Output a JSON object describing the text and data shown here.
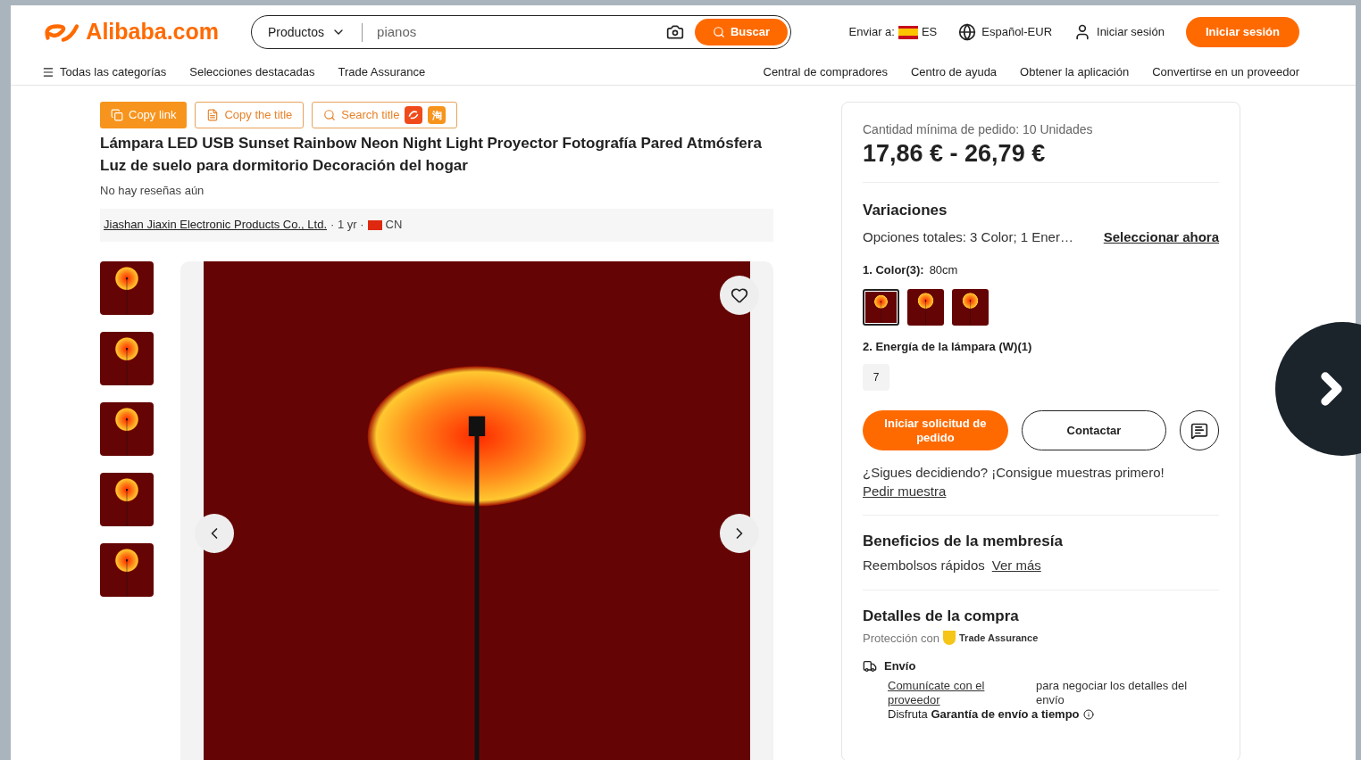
{
  "header": {
    "logo": "Alibaba.com",
    "search": {
      "category": "Productos",
      "value": "pianos",
      "button": "Buscar"
    },
    "ship_to": {
      "label": "Enviar a:",
      "country": "ES"
    },
    "language": "Español-EUR",
    "sign_in_link": "Iniciar sesión",
    "sign_in_button": "Iniciar sesión"
  },
  "nav": {
    "left": [
      "Todas las categorías",
      "Selecciones destacadas",
      "Trade Assurance"
    ],
    "right": [
      "Central de compradores",
      "Centro de ayuda",
      "Obtener la aplicación",
      "Convertirse en un proveedor"
    ]
  },
  "tools": [
    {
      "label": "Copy link",
      "kind": "filled"
    },
    {
      "label": "Copy the title",
      "kind": "outline"
    },
    {
      "label": "Search title",
      "kind": "search",
      "badge": "淘"
    }
  ],
  "product": {
    "title": "Lámpara LED USB Sunset Rainbow Neon Night Light Proyector Fotografía Pared Atmósfera Luz de suelo para dormitorio Decoración del hogar",
    "reviews": "No hay reseñas aún",
    "supplier": {
      "name": "Jiashan Jiaxin Electronic Products Co., Ltd.",
      "years": "· 1 yr ·",
      "country": "CN"
    }
  },
  "gallery": {
    "thumbnails": [
      {
        "selected": false
      },
      {
        "selected": false
      },
      {
        "selected": false
      },
      {
        "selected": false
      },
      {
        "selected": false
      }
    ]
  },
  "order": {
    "min_order": "Cantidad mínima de pedido: 10 Unidades",
    "price": "17,86 € - 26,79 €"
  },
  "variations": {
    "heading": "Variaciones",
    "summary": "Opciones totales: 3 Color; 1 Ener…",
    "select_link": "Seleccionar ahora",
    "color": {
      "label": "1. Color(3):",
      "value": "80cm",
      "swatches": [
        {
          "selected": true
        },
        {
          "selected": false
        },
        {
          "selected": false
        }
      ]
    },
    "power": {
      "label": "2. Energía de la lámpara (W)(1)",
      "options": [
        {
          "label": "7",
          "selected": false
        }
      ]
    }
  },
  "actions": {
    "order_button": "Iniciar solicitud de pedido",
    "contact_button": "Contactar"
  },
  "sample": {
    "text": "¿Sigues decidiendo? ¡Consigue muestras primero!",
    "link": "Pedir muestra"
  },
  "membership": {
    "heading": "Beneficios de la membresía",
    "text": "Reembolsos rápidos",
    "link": "Ver más"
  },
  "purchase": {
    "heading": "Detalles de la compra",
    "protection": "Protección con",
    "trade_assurance": "Trade Assurance",
    "shipping": {
      "label": "Envío",
      "link": "Comunícate con el proveedor",
      "text": "para negociar los detalles del envío",
      "guarantee": "Disfruta **Garantía de envío a tiempo**"
    }
  }
}
